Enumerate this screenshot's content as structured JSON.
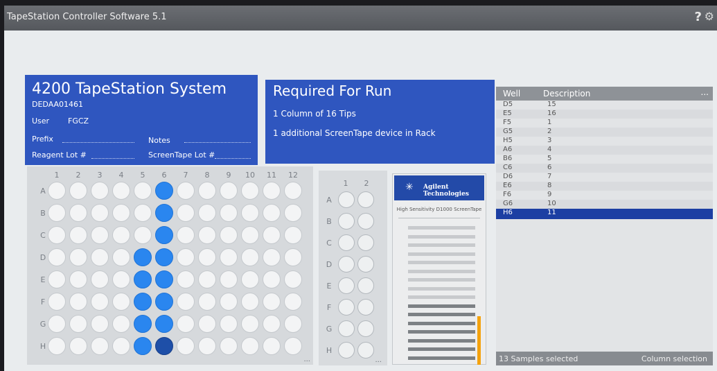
{
  "app": {
    "title": "TapeStation Controller Software 5.1",
    "help_glyph": "?",
    "settings_glyph": "⚙"
  },
  "system": {
    "title": "4200 TapeStation System",
    "serial": "DEDAA01461",
    "user_label": "User",
    "user_value": "FGCZ",
    "prefix_label": "Prefix",
    "notes_label": "Notes",
    "reagent_lot_label": "Reagent Lot #",
    "screentape_lot_label": "ScreenTape Lot #"
  },
  "required": {
    "title": "Required For Run",
    "items": [
      "1 Column of 16 Tips",
      "1 additional ScreenTape device in Rack"
    ]
  },
  "plate": {
    "columns": [
      "1",
      "2",
      "3",
      "4",
      "5",
      "6",
      "7",
      "8",
      "9",
      "10",
      "11",
      "12"
    ],
    "rows": [
      "A",
      "B",
      "C",
      "D",
      "E",
      "F",
      "G",
      "H"
    ],
    "selected_wells": [
      "A6",
      "B6",
      "C6",
      "D5",
      "D6",
      "E5",
      "E6",
      "F5",
      "F6",
      "G5",
      "G6",
      "H5"
    ],
    "current_well": "H6",
    "more": "..."
  },
  "tips": {
    "columns": [
      "1",
      "2"
    ],
    "rows": [
      "A",
      "B",
      "C",
      "D",
      "E",
      "F",
      "G",
      "H"
    ],
    "more": "..."
  },
  "screentape": {
    "brand": "Agilent Technologies",
    "logo_icon": "agilent-spark-icon",
    "type": "High Sensitivity D1000 ScreenTape",
    "lanes_total": 16,
    "lanes_used": 7,
    "indicator_color": "#f4a20e"
  },
  "samples": {
    "header_well": "Well",
    "header_description": "Description",
    "header_more": "...",
    "rows": [
      {
        "well": "D5",
        "desc": "15"
      },
      {
        "well": "E5",
        "desc": "16"
      },
      {
        "well": "F5",
        "desc": "1"
      },
      {
        "well": "G5",
        "desc": "2"
      },
      {
        "well": "H5",
        "desc": "3"
      },
      {
        "well": "A6",
        "desc": "4"
      },
      {
        "well": "B6",
        "desc": "5"
      },
      {
        "well": "C6",
        "desc": "6"
      },
      {
        "well": "D6",
        "desc": "7"
      },
      {
        "well": "E6",
        "desc": "8"
      },
      {
        "well": "F6",
        "desc": "9"
      },
      {
        "well": "G6",
        "desc": "10"
      },
      {
        "well": "H6",
        "desc": "11"
      }
    ],
    "selected_row": "H6",
    "footer_count": "13 Samples selected",
    "footer_mode": "Column selection"
  },
  "colors": {
    "panel_blue": "#2f56bf",
    "well_selected": "#2a86ef",
    "well_current": "#1e4fa8",
    "row_selected": "#1c3fa3"
  }
}
